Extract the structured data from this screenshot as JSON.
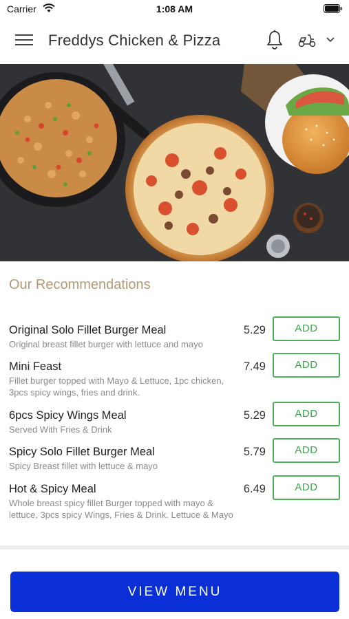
{
  "status_bar": {
    "carrier": "Carrier",
    "time": "1:08 AM",
    "icons": [
      "wifi-icon",
      "battery-icon"
    ]
  },
  "header": {
    "title": "Freddys Chicken & Pizza",
    "icons": [
      "menu-icon",
      "bell-icon",
      "scooter-icon",
      "chevron-down-icon"
    ]
  },
  "hero": {
    "image": "food spread: fried rice pan, pizza, burger, spices"
  },
  "recommendations": {
    "title": "Our Recommendations",
    "add_label": "ADD",
    "items": [
      {
        "name": "Original Solo Fillet Burger Meal",
        "description": "Original breast fillet burger with lettuce and mayo",
        "price": "5.29"
      },
      {
        "name": "Mini Feast",
        "description": "Fillet burger topped with Mayo & Lettuce, 1pc chicken, 3pcs spicy wings, fries and drink.",
        "price": "7.49"
      },
      {
        "name": "6pcs Spicy Wings Meal",
        "description": "Served With Fries & Drink",
        "price": "5.29"
      },
      {
        "name": "Spicy Solo Fillet Burger Meal",
        "description": "Spicy Breast fillet with lettuce & mayo",
        "price": "5.79"
      },
      {
        "name": "Hot & Spicy Meal",
        "description": "Whole breast spicy fillet Burger topped with mayo & lettuce, 3pcs spicy Wings, Fries & Drink. Lettuce & Mayo",
        "price": "6.49"
      }
    ]
  },
  "footer": {
    "view_menu_label": "VIEW MENU"
  },
  "colors": {
    "accent_button": "#0a2fd6",
    "add_border": "#4caf5a",
    "section_title": "#b39a72"
  }
}
